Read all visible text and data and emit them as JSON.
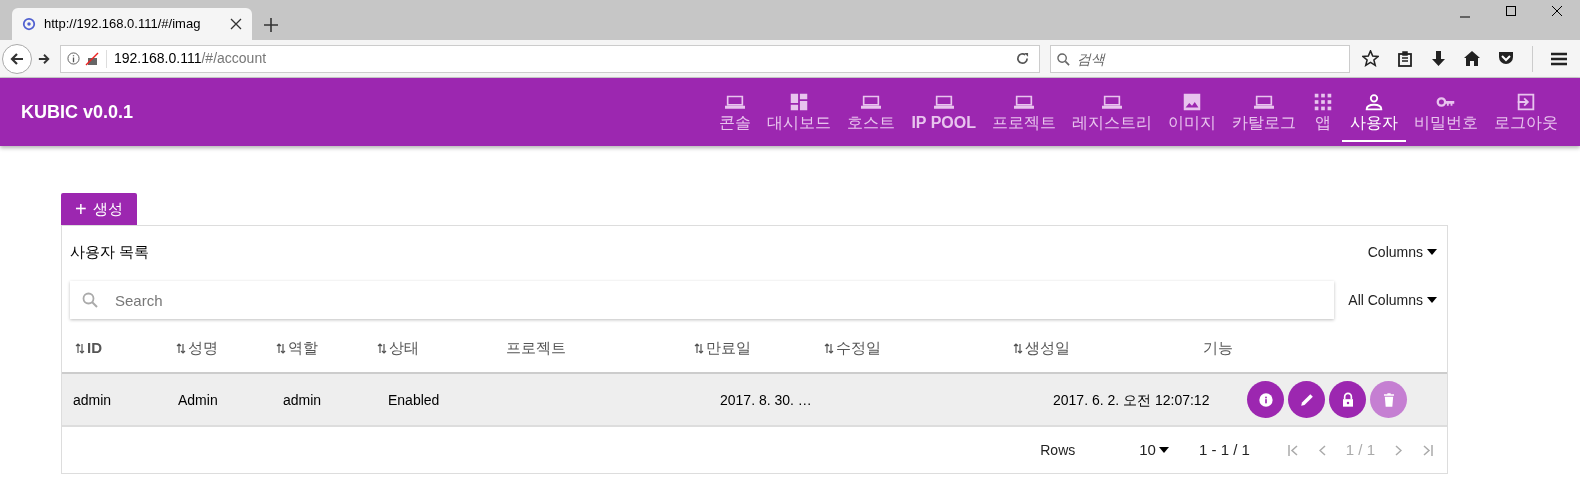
{
  "browser": {
    "tab_title": "http://192.168.0.111/#/imag",
    "url_host": "192.168.0.111",
    "url_path": "/#/account",
    "search_placeholder": "검색"
  },
  "app": {
    "title": "KUBIC v0.0.1",
    "nav": [
      {
        "kind": "laptop",
        "label": "콘솔",
        "selected": false,
        "bold": false
      },
      {
        "kind": "dashboard",
        "label": "대시보드",
        "selected": false,
        "bold": false
      },
      {
        "kind": "laptop",
        "label": "호스트",
        "selected": false,
        "bold": false
      },
      {
        "kind": "laptop",
        "label": "IP POOL",
        "selected": false,
        "bold": true
      },
      {
        "kind": "laptop",
        "label": "프로젝트",
        "selected": false,
        "bold": false
      },
      {
        "kind": "laptop",
        "label": "레지스트리",
        "selected": false,
        "bold": false
      },
      {
        "kind": "image",
        "label": "이미지",
        "selected": false,
        "bold": false
      },
      {
        "kind": "laptop",
        "label": "카탈로그",
        "selected": false,
        "bold": false
      },
      {
        "kind": "apps",
        "label": "앱",
        "selected": false,
        "bold": false
      },
      {
        "kind": "person",
        "label": "사용자",
        "selected": true,
        "bold": false
      },
      {
        "kind": "key",
        "label": "비밀번호",
        "selected": false,
        "bold": false
      },
      {
        "kind": "logout",
        "label": "로그아웃",
        "selected": false,
        "bold": false
      }
    ]
  },
  "create_button": {
    "icon": "+",
    "label": "생성"
  },
  "table": {
    "title": "사용자 목록",
    "columns_menu": "Columns",
    "search_placeholder": "Search",
    "filter_menu": "All Columns",
    "columns": [
      {
        "label": "ID",
        "sortable": true,
        "bold": true
      },
      {
        "label": "성명",
        "sortable": true,
        "bold": false
      },
      {
        "label": "역할",
        "sortable": true,
        "bold": false
      },
      {
        "label": "상태",
        "sortable": true,
        "bold": false
      },
      {
        "label": "프로젝트",
        "sortable": false,
        "bold": false
      },
      {
        "label": "만료일",
        "sortable": true,
        "bold": false
      },
      {
        "label": "수정일",
        "sortable": true,
        "bold": false
      },
      {
        "label": "생성일",
        "sortable": true,
        "bold": false
      },
      {
        "label": "기능",
        "sortable": false,
        "bold": false
      }
    ],
    "rows": [
      {
        "cells": [
          "admin",
          "Admin",
          "admin",
          "Enabled",
          "",
          "2017. 8. 30. …",
          "",
          "2017. 6. 2. 오전 12:07:12"
        ],
        "actions": [
          {
            "kind": "info",
            "disabled": false
          },
          {
            "kind": "edit",
            "disabled": false
          },
          {
            "kind": "lock",
            "disabled": false
          },
          {
            "kind": "delete",
            "disabled": true
          }
        ]
      }
    ]
  },
  "pagination": {
    "rows_label": "Rows",
    "rows_per_page": "10",
    "range": "1 - 1 / 1",
    "page": "1 / 1"
  }
}
